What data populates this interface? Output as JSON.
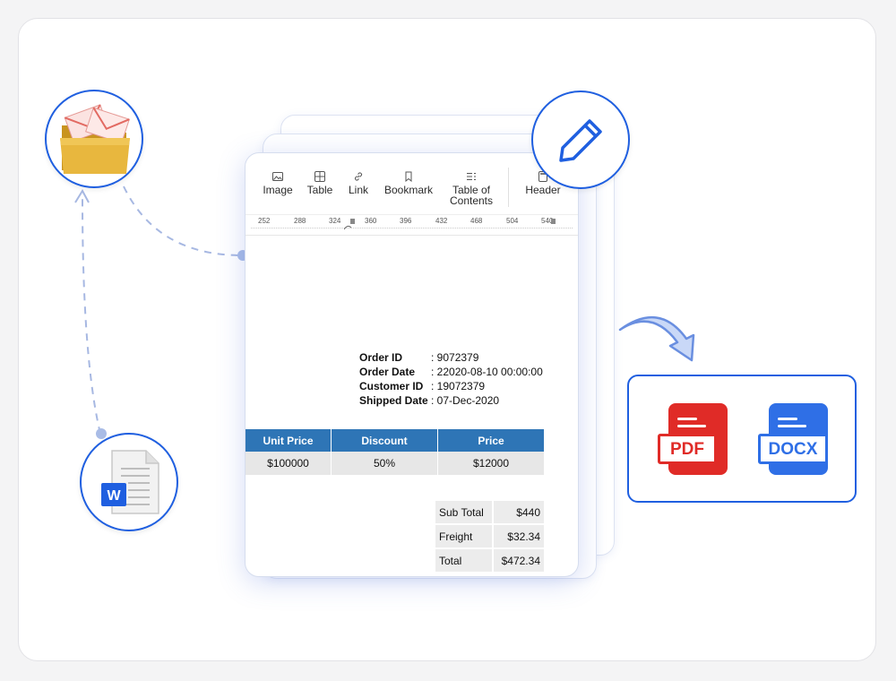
{
  "toolbar": {
    "items": [
      {
        "label": "Image",
        "icon": "image-icon"
      },
      {
        "label": "Table",
        "icon": "table-icon"
      },
      {
        "label": "Link",
        "icon": "link-icon"
      },
      {
        "label": "Bookmark",
        "icon": "bookmark-icon"
      },
      {
        "label": "Table of Contents",
        "icon": "table-of-contents-icon"
      },
      {
        "label": "Header",
        "icon": "header-icon"
      }
    ]
  },
  "ruler": {
    "ticks": [
      "252",
      "288",
      "324",
      "360",
      "396",
      "432",
      "468",
      "504",
      "540"
    ]
  },
  "order": {
    "fields": [
      {
        "label": "Order ID",
        "value": ": 9072379"
      },
      {
        "label": "Order Date",
        "value": ": 22020-08-10 00:00:00"
      },
      {
        "label": "Customer ID",
        "value": ": 19072379"
      },
      {
        "label": "Shipped Date",
        "value": ": 07-Dec-2020"
      }
    ]
  },
  "items_table": {
    "headers": [
      "Unit Price",
      "Discount",
      "Price"
    ],
    "rows": [
      [
        "$100000",
        "50%",
        "$12000"
      ]
    ]
  },
  "totals": [
    {
      "label": "Sub Total",
      "amount": "$440"
    },
    {
      "label": "Freight",
      "amount": "$32.34"
    },
    {
      "label": "Total",
      "amount": "$472.34"
    }
  ],
  "export": {
    "pdf_label": "PDF",
    "docx_label": "DOCX"
  },
  "icons": [
    "folder-mail-icon",
    "pencil-icon",
    "word-document-icon",
    "arrow-icon"
  ],
  "colors": {
    "accent": "#1f5fe0",
    "table_header": "#2e75b6",
    "pdf": "#e02b27",
    "docx": "#2f6fe6"
  }
}
